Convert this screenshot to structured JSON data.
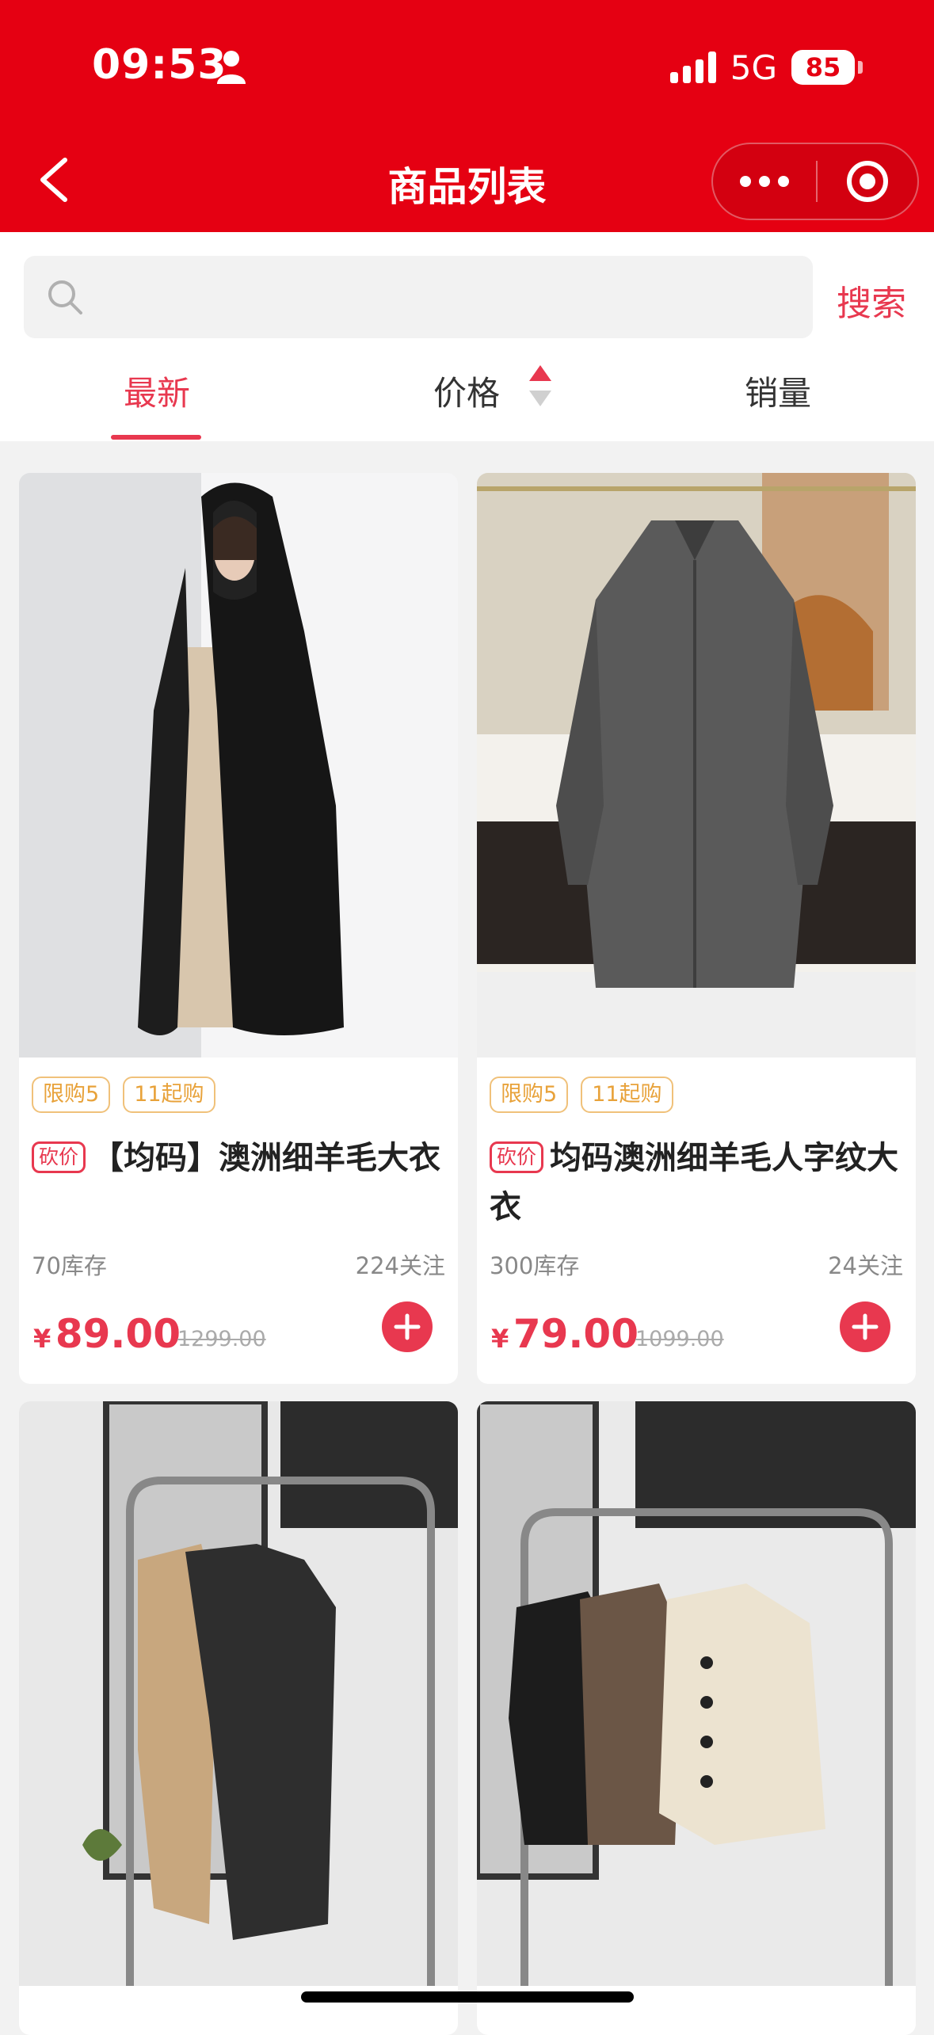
{
  "status_bar": {
    "time": "09:53",
    "network": "5G",
    "battery": "85"
  },
  "nav": {
    "title": "商品列表"
  },
  "search": {
    "placeholder": "",
    "button_label": "搜索"
  },
  "tabs": [
    {
      "label": "最新",
      "active": true
    },
    {
      "label": "价格",
      "active": false
    },
    {
      "label": "销量",
      "active": false
    }
  ],
  "products": [
    {
      "tags": [
        "限购5",
        "11起购"
      ],
      "badge": "砍价",
      "title": "【均码】澳洲细羊毛大衣",
      "stock": "70库存",
      "follows": "224关注",
      "currency": "¥",
      "price": "89.00",
      "original_price": "1299.00"
    },
    {
      "tags": [
        "限购5",
        "11起购"
      ],
      "badge": "砍价",
      "title": "均码澳洲细羊毛人字纹大衣",
      "stock": "300库存",
      "follows": "24关注",
      "currency": "¥",
      "price": "79.00",
      "original_price": "1099.00"
    }
  ],
  "colors": {
    "brand": "#e50012",
    "accent": "#e8384f",
    "tag": "#e8a23a"
  }
}
